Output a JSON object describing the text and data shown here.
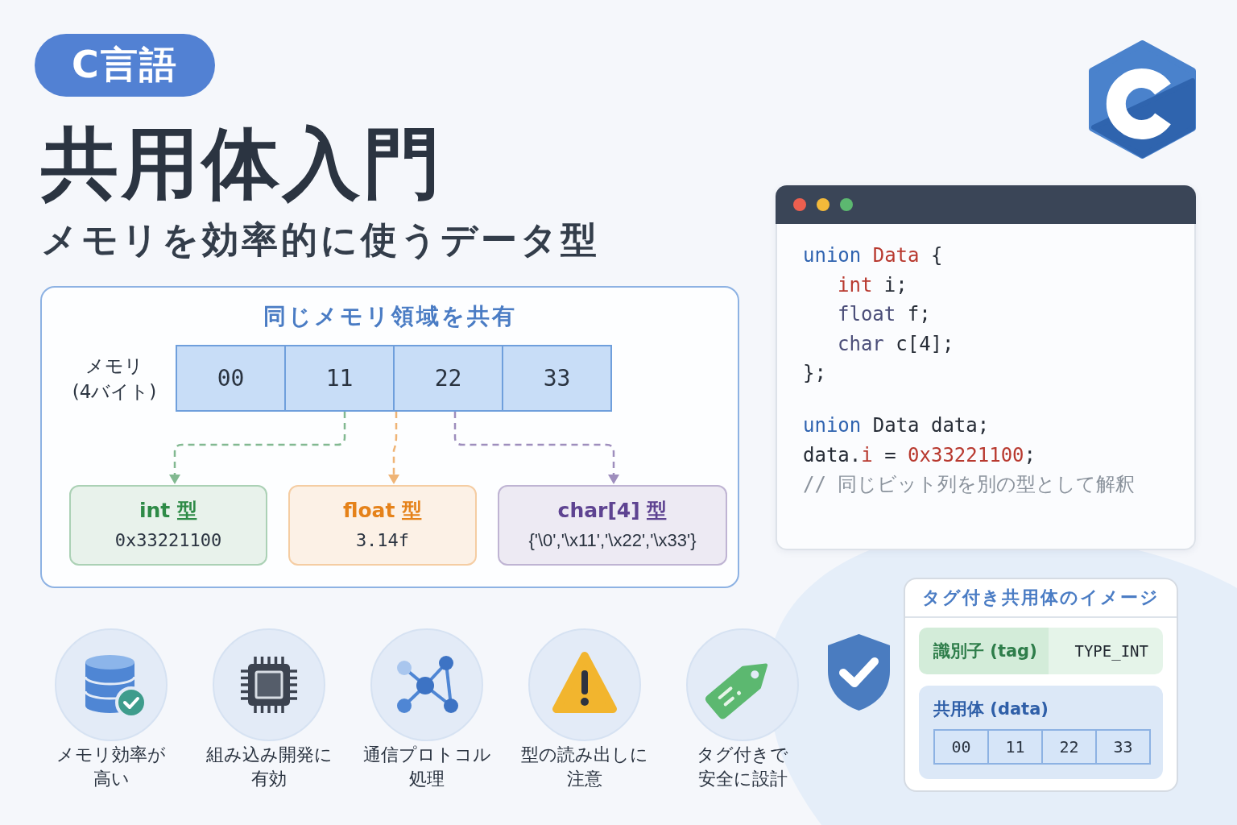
{
  "badge": {
    "text": "C言語"
  },
  "title": "共用体入門",
  "subtitle": "メモリを効率的に使うデータ型",
  "diagram": {
    "title": "同じメモリ領域を共有",
    "memory_label": "メモリ\n(4バイト)",
    "bytes": [
      "00",
      "11",
      "22",
      "33"
    ],
    "views": [
      {
        "type": "int 型",
        "value": "0x33221100",
        "kind": "number",
        "color": "#2e8b47"
      },
      {
        "type": "float 型",
        "value": "3.14f",
        "kind": "number",
        "color": "#e5821a"
      },
      {
        "type": "char[4] 型",
        "value": "{'\\0','\\x11','\\x22','\\x33'}",
        "kind": "chars",
        "color": "#5e4391"
      }
    ]
  },
  "features": [
    {
      "kind": "database",
      "lines": [
        "メモリ効率が",
        "高い"
      ]
    },
    {
      "kind": "chip",
      "lines": [
        "組み込み開発に",
        "有効"
      ]
    },
    {
      "kind": "network",
      "lines": [
        "通信プロトコル",
        "処理"
      ]
    },
    {
      "kind": "warning",
      "lines": [
        "型の読み出しに",
        "注意"
      ]
    },
    {
      "kind": "tag",
      "lines": [
        "タグ付きで",
        "安全に設計"
      ]
    }
  ],
  "code_window": {
    "dots": [
      {
        "color": "#ec5f4f"
      },
      {
        "color": "#f3b93a"
      },
      {
        "color": "#5cb870"
      }
    ],
    "blocks": [
      {
        "lines": [
          {
            "indented": false,
            "tokens": [
              {
                "text": "union ",
                "kind": "keyword"
              },
              {
                "text": "Data",
                "kind": "accent"
              },
              {
                "text": " {",
                "kind": "plain"
              }
            ]
          },
          {
            "indented": true,
            "tokens": [
              {
                "text": "int",
                "kind": "accent"
              },
              {
                "text": " i;",
                "kind": "plain"
              }
            ]
          },
          {
            "indented": true,
            "tokens": [
              {
                "text": "float",
                "kind": "type"
              },
              {
                "text": " f;",
                "kind": "plain"
              }
            ]
          },
          {
            "indented": true,
            "tokens": [
              {
                "text": "char",
                "kind": "type"
              },
              {
                "text": " c[4];",
                "kind": "plain"
              }
            ]
          },
          {
            "indented": false,
            "tokens": [
              {
                "text": "};",
                "kind": "plain"
              }
            ]
          }
        ]
      },
      {
        "lines": [
          {
            "indented": false,
            "tokens": [
              {
                "text": "union ",
                "kind": "keyword"
              },
              {
                "text": "Data data;",
                "kind": "plain"
              }
            ]
          },
          {
            "indented": false,
            "tokens": [
              {
                "text": "data.",
                "kind": "plain"
              },
              {
                "text": "i",
                "kind": "accent"
              },
              {
                "text": " = ",
                "kind": "plain"
              },
              {
                "text": "0x33221100",
                "kind": "accent"
              },
              {
                "text": ";",
                "kind": "plain"
              }
            ]
          },
          {
            "indented": false,
            "tokens": [
              {
                "text": "// 同じビット列を別の型として解釈",
                "kind": "comment"
              }
            ]
          }
        ]
      }
    ]
  },
  "tagged_union": {
    "title": "タグ付き共用体のイメージ",
    "tag_label": "識別子 (tag)",
    "tag_value": "TYPE_INT",
    "data_label": "共用体 (data)",
    "bytes": [
      "00",
      "11",
      "22",
      "33"
    ]
  }
}
